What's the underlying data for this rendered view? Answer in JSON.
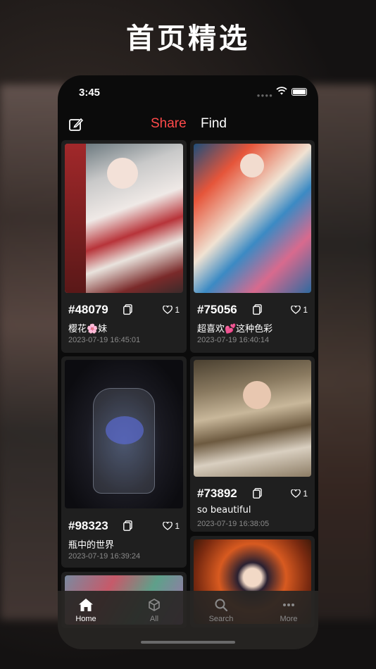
{
  "headline": "首页精选",
  "status": {
    "time": "3:45"
  },
  "nav": {
    "tabs": [
      {
        "label": "Share",
        "active": true
      },
      {
        "label": "Find",
        "active": false
      }
    ],
    "edit_icon": "edit-icon"
  },
  "posts": [
    {
      "id": "#48079",
      "likes": "1",
      "caption": "樱花🌸妹",
      "date": "2023-07-19 16:45:01"
    },
    {
      "id": "#75056",
      "likes": "1",
      "caption": "超喜欢💕这种色彩",
      "date": "2023-07-19 16:40:14"
    },
    {
      "id": "#98323",
      "likes": "1",
      "caption": "瓶中的世界",
      "date": "2023-07-19 16:39:24"
    },
    {
      "id": "#73892",
      "likes": "1",
      "caption": "so beautiful",
      "date": "2023-07-19 16:38:05"
    }
  ],
  "tabbar": [
    {
      "label": "Home",
      "icon": "home-icon",
      "active": true
    },
    {
      "label": "All",
      "icon": "cubes-icon",
      "active": false
    },
    {
      "label": "Search",
      "icon": "search-icon",
      "active": false
    },
    {
      "label": "More",
      "icon": "more-icon",
      "active": false
    }
  ],
  "colors": {
    "accent": "#ff4a4a",
    "background": "#0b0b0b",
    "card": "#1f1f1f"
  }
}
